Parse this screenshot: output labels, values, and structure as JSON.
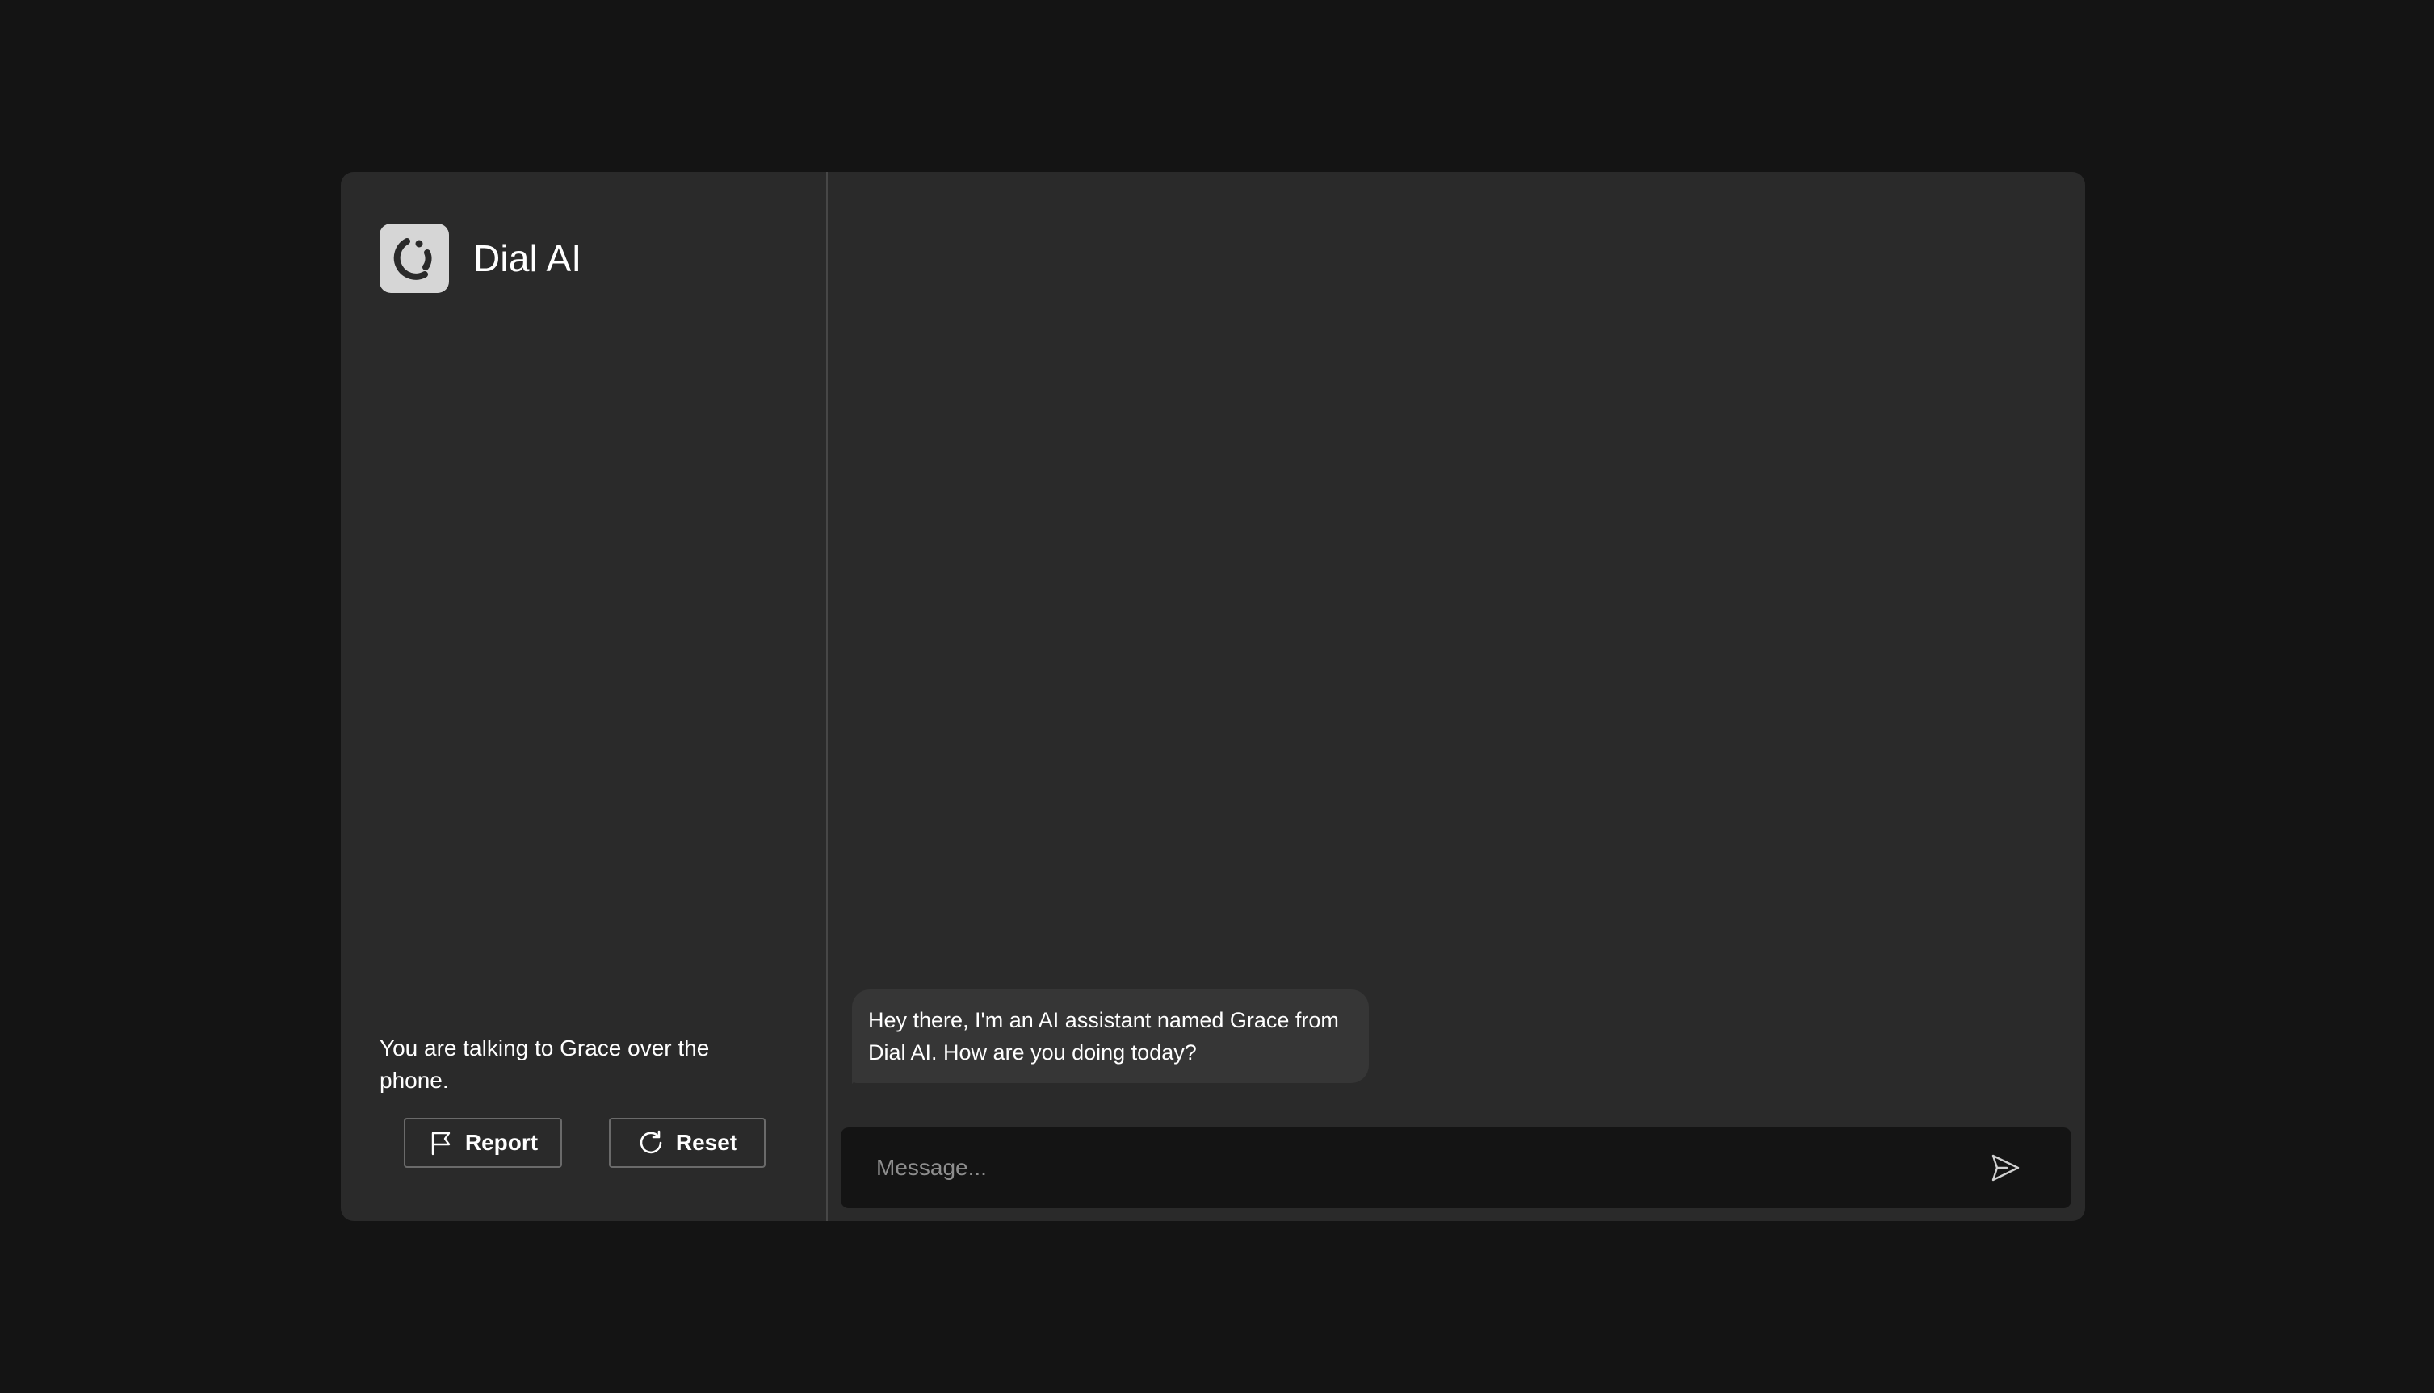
{
  "brand": {
    "name": "Dial AI",
    "logo_icon": "dial-ai-logo-icon"
  },
  "sidebar": {
    "status_text": "You are talking to Grace over the phone.",
    "buttons": {
      "report": {
        "label": "Report",
        "icon": "flag-icon"
      },
      "reset": {
        "label": "Reset",
        "icon": "refresh-icon"
      }
    }
  },
  "chat": {
    "messages": [
      {
        "sender": "assistant",
        "text": "Hey there, I'm an AI assistant named Grace from Dial AI. How are you doing today?"
      }
    ],
    "composer": {
      "placeholder": "Message...",
      "value": "",
      "send_icon": "send-icon"
    }
  },
  "colors": {
    "page_background": "#141414",
    "panel_background": "#2a2a2a",
    "bubble_background": "#363636",
    "input_background": "#141414",
    "divider": "#474747",
    "text": "#ffffff",
    "placeholder": "#8e8e8e"
  }
}
